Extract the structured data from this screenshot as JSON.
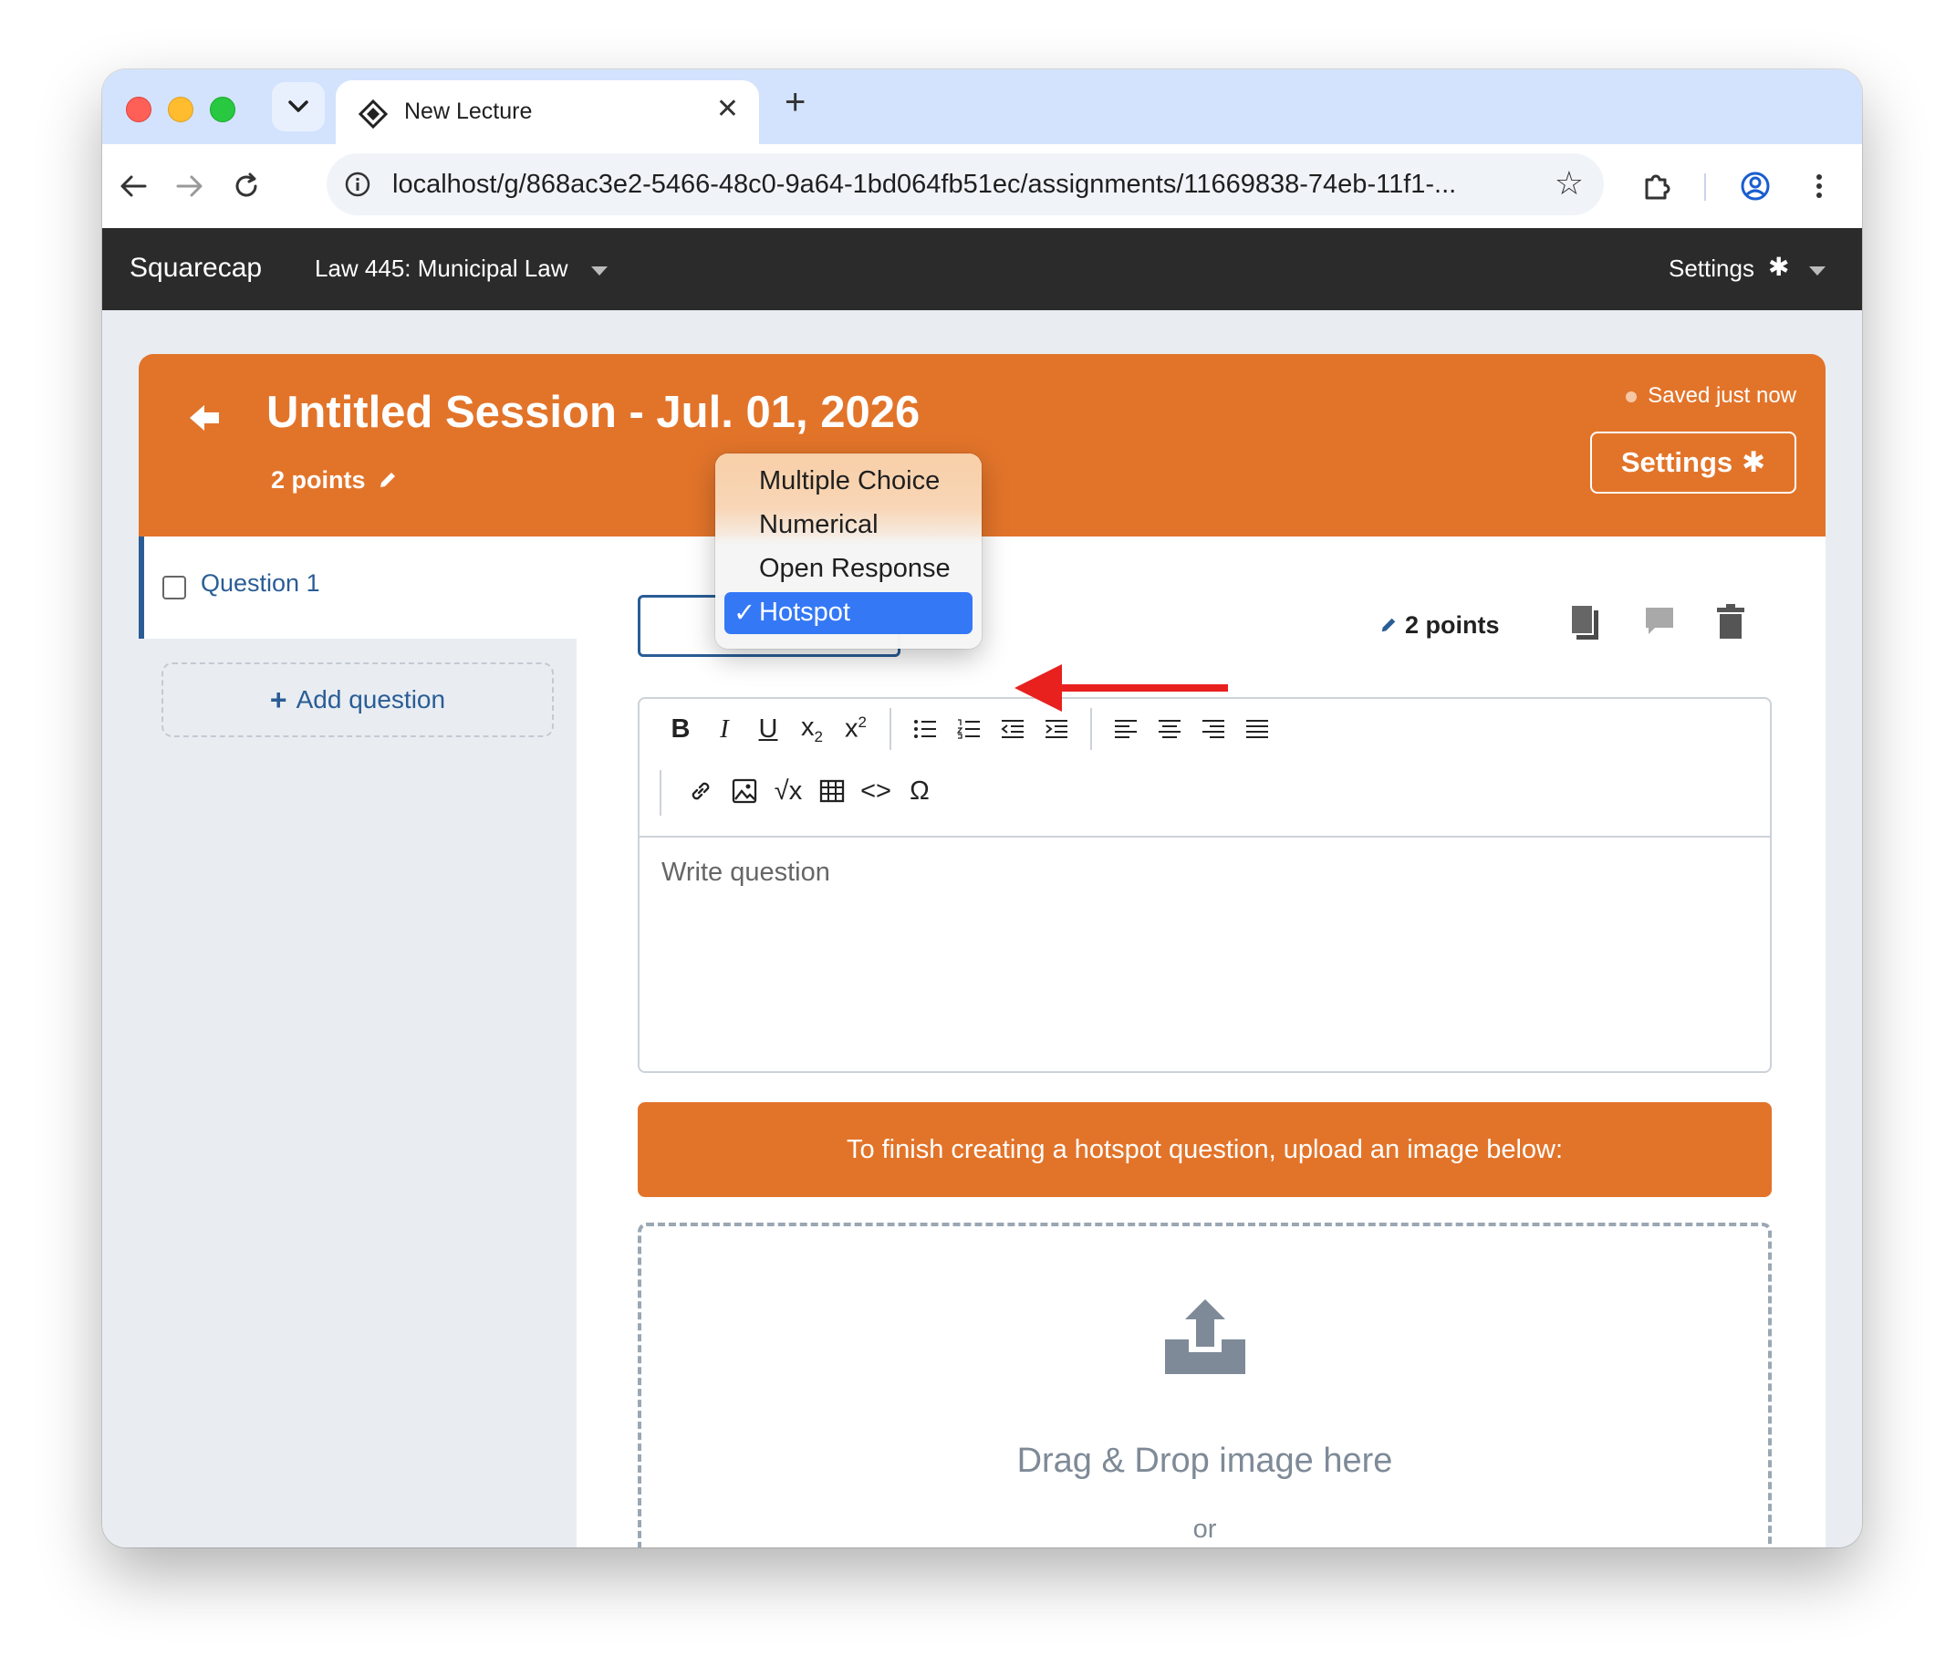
{
  "browser": {
    "tab_title": "New Lecture",
    "url": "localhost/g/868ac3e2-5466-48c0-9a64-1bd064fb51ec/assignments/11669838-74eb-11f1-..."
  },
  "navbar": {
    "brand": "Squarecap",
    "course": "Law 445: Municipal Law",
    "settings": "Settings"
  },
  "header": {
    "title": "Untitled Session - Jul. 01, 2026",
    "points": "2 points",
    "saved_status": "Saved just now",
    "settings_button": "Settings"
  },
  "sidebar": {
    "questions": [
      {
        "label": "Question 1"
      }
    ],
    "add_question": "Add question"
  },
  "question": {
    "points": "2 points",
    "editor_placeholder": "Write question",
    "hotspot_banner": "To finish creating a hotspot question, upload an image below:",
    "dropzone_text": "Drag & Drop image here",
    "dropzone_or": "or"
  },
  "question_type_dropdown": {
    "options": [
      "Multiple Choice",
      "Numerical",
      "Open Response",
      "Hotspot"
    ],
    "selected": "Hotspot"
  },
  "editor_toolbar": {
    "bold": "B",
    "italic": "I",
    "underline": "U",
    "omega": "Ω",
    "code": "<>"
  },
  "colors": {
    "accent_orange": "#e2742a",
    "link_blue": "#2a5d96",
    "navbar": "#2b2b2b",
    "selection_blue": "#3478f6",
    "arrow_red": "#e8201e"
  }
}
